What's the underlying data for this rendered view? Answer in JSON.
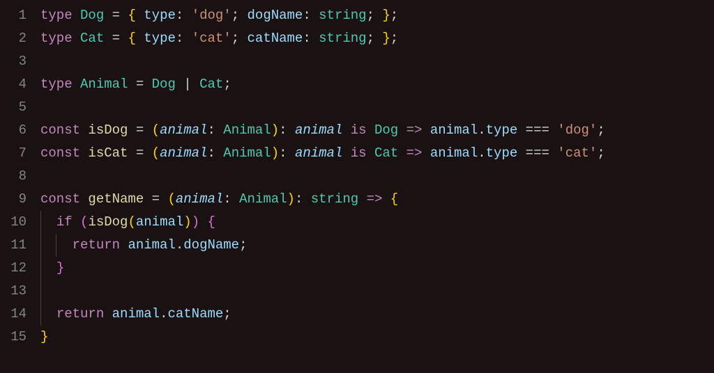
{
  "lineNumbers": [
    "1",
    "2",
    "3",
    "4",
    "5",
    "6",
    "7",
    "8",
    "9",
    "10",
    "11",
    "12",
    "13",
    "14",
    "15"
  ],
  "code": {
    "l1": {
      "kw_type": "type",
      "sp1": " ",
      "name": "Dog",
      "sp2": " ",
      "eq": "=",
      "sp3": " ",
      "lb": "{",
      "sp4": " ",
      "p1": "type",
      "c1": ":",
      "sp5": " ",
      "s1": "'dog'",
      "sc1": ";",
      "sp6": " ",
      "p2": "dogName",
      "c2": ":",
      "sp7": " ",
      "t2": "string",
      "sc2": ";",
      "sp8": " ",
      "rb": "}",
      "sc3": ";"
    },
    "l2": {
      "kw_type": "type",
      "sp1": " ",
      "name": "Cat",
      "sp2": " ",
      "eq": "=",
      "sp3": " ",
      "lb": "{",
      "sp4": " ",
      "p1": "type",
      "c1": ":",
      "sp5": " ",
      "s1": "'cat'",
      "sc1": ";",
      "sp6": " ",
      "p2": "catName",
      "c2": ":",
      "sp7": " ",
      "t2": "string",
      "sc2": ";",
      "sp8": " ",
      "rb": "}",
      "sc3": ";"
    },
    "l4": {
      "kw_type": "type",
      "sp1": " ",
      "name": "Animal",
      "sp2": " ",
      "eq": "=",
      "sp3": " ",
      "a": "Dog",
      "sp4": " ",
      "pipe": "|",
      "sp5": " ",
      "b": "Cat",
      "sc": ";"
    },
    "l6": {
      "kw": "const",
      "sp1": " ",
      "fn": "isDog",
      "sp2": " ",
      "eq": "=",
      "sp3": " ",
      "lp": "(",
      "param": "animal",
      "c1": ":",
      "sp4": " ",
      "ptype": "Animal",
      "rp": ")",
      "c2": ":",
      "sp5": " ",
      "param2": "animal",
      "sp6": " ",
      "is": "is",
      "sp7": " ",
      "rtype": "Dog",
      "sp8": " ",
      "arrow": "=>",
      "sp9": " ",
      "obj": "animal",
      "dot": ".",
      "prop": "type",
      "sp10": " ",
      "eqeq": "===",
      "sp11": " ",
      "str": "'dog'",
      "sc": ";"
    },
    "l7": {
      "kw": "const",
      "sp1": " ",
      "fn": "isCat",
      "sp2": " ",
      "eq": "=",
      "sp3": " ",
      "lp": "(",
      "param": "animal",
      "c1": ":",
      "sp4": " ",
      "ptype": "Animal",
      "rp": ")",
      "c2": ":",
      "sp5": " ",
      "param2": "animal",
      "sp6": " ",
      "is": "is",
      "sp7": " ",
      "rtype": "Cat",
      "sp8": " ",
      "arrow": "=>",
      "sp9": " ",
      "obj": "animal",
      "dot": ".",
      "prop": "type",
      "sp10": " ",
      "eqeq": "===",
      "sp11": " ",
      "str": "'cat'",
      "sc": ";"
    },
    "l9": {
      "kw": "const",
      "sp1": " ",
      "fn": "getName",
      "sp2": " ",
      "eq": "=",
      "sp3": " ",
      "lp": "(",
      "param": "animal",
      "c1": ":",
      "sp4": " ",
      "ptype": "Animal",
      "rp": ")",
      "c2": ":",
      "sp5": " ",
      "rtype": "string",
      "sp6": " ",
      "arrow": "=>",
      "sp7": " ",
      "lb": "{"
    },
    "l10": {
      "indent": "  ",
      "kw": "if",
      "sp1": " ",
      "lp": "(",
      "fn": "isDog",
      "lp2": "(",
      "arg": "animal",
      "rp2": ")",
      "rp": ")",
      "sp2": " ",
      "lb": "{"
    },
    "l11": {
      "indent": "    ",
      "kw": "return",
      "sp1": " ",
      "obj": "animal",
      "dot": ".",
      "prop": "dogName",
      "sc": ";"
    },
    "l12": {
      "indent": "  ",
      "rb": "}"
    },
    "l14": {
      "indent": "  ",
      "kw": "return",
      "sp1": " ",
      "obj": "animal",
      "dot": ".",
      "prop": "catName",
      "sc": ";"
    },
    "l15": {
      "rb": "}"
    }
  }
}
